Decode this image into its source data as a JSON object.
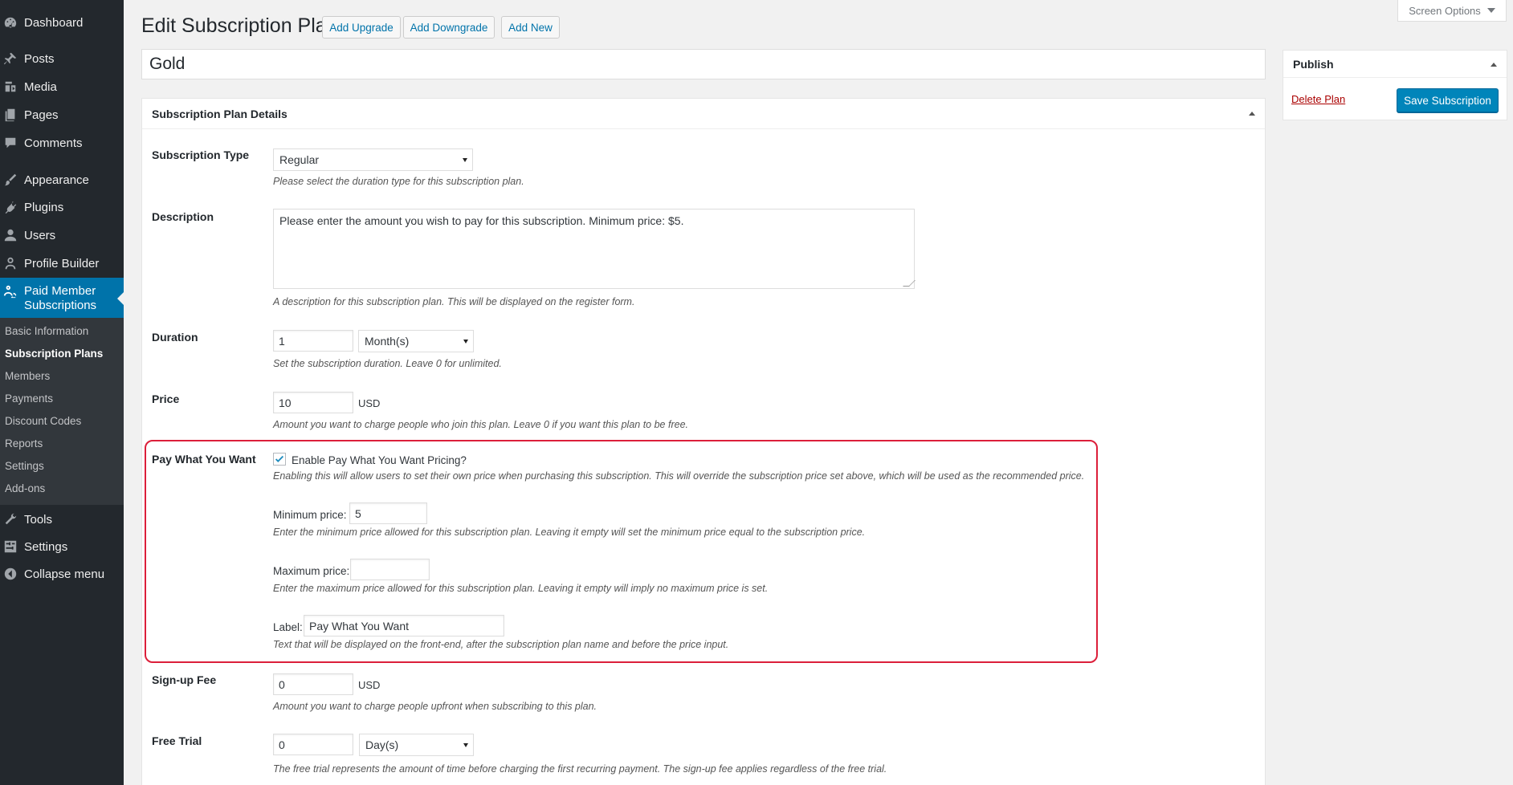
{
  "sidebar": {
    "items": [
      {
        "label": "Dashboard",
        "icon": "dashboard-icon"
      },
      {
        "label": "Posts",
        "icon": "pin-icon"
      },
      {
        "label": "Media",
        "icon": "media-icon"
      },
      {
        "label": "Pages",
        "icon": "pages-icon"
      },
      {
        "label": "Comments",
        "icon": "comment-icon"
      },
      {
        "label": "Appearance",
        "icon": "brush-icon"
      },
      {
        "label": "Plugins",
        "icon": "plug-icon"
      },
      {
        "label": "Users",
        "icon": "user-icon"
      },
      {
        "label": "Profile Builder",
        "icon": "profile-icon"
      },
      {
        "label": "Paid Member Subscriptions",
        "icon": "members-icon"
      },
      {
        "label": "Tools",
        "icon": "wrench-icon"
      },
      {
        "label": "Settings",
        "icon": "sliders-icon"
      },
      {
        "label": "Collapse menu",
        "icon": "collapse-icon"
      }
    ],
    "submenu": [
      "Basic Information",
      "Subscription Plans",
      "Members",
      "Payments",
      "Discount Codes",
      "Reports",
      "Settings",
      "Add-ons"
    ],
    "active_submenu": "Subscription Plans"
  },
  "header": {
    "title": "Edit Subscription Plan",
    "buttons": [
      "Add Upgrade",
      "Add Downgrade",
      "Add New"
    ],
    "screen_options": "Screen Options"
  },
  "plan_title": "Gold",
  "details": {
    "box_title": "Subscription Plan Details",
    "subscription_type": {
      "label": "Subscription Type",
      "value": "Regular",
      "desc": "Please select the duration type for this subscription plan."
    },
    "description": {
      "label": "Description",
      "value": "Please enter the amount you wish to pay for this subscription. Minimum price: $5.",
      "desc": "A description for this subscription plan. This will be displayed on the register form."
    },
    "duration": {
      "label": "Duration",
      "value": "1",
      "unit": "Month(s)",
      "desc": "Set the subscription duration. Leave 0 for unlimited."
    },
    "price": {
      "label": "Price",
      "value": "10",
      "currency": "USD",
      "desc": "Amount you want to charge people who join this plan. Leave 0 if you want this plan to be free."
    },
    "pwyw": {
      "label": "Pay What You Want",
      "checkbox_label": "Enable Pay What You Want Pricing?",
      "checked": true,
      "checkbox_desc": "Enabling this will allow users to set their own price when purchasing this subscription. This will override the subscription price set above, which will be used as the recommended price.",
      "min_label": "Minimum price:",
      "min_value": "5",
      "min_desc": "Enter the minimum price allowed for this subscription plan. Leaving it empty will set the minimum price equal to the subscription price.",
      "max_label": "Maximum price:",
      "max_value": "",
      "max_desc": "Enter the maximum price allowed for this subscription plan. Leaving it empty will imply no maximum price is set.",
      "text_label": "Label:",
      "text_value": "Pay What You Want",
      "text_desc": "Text that will be displayed on the front-end, after the subscription plan name and before the price input."
    },
    "signup_fee": {
      "label": "Sign-up Fee",
      "value": "0",
      "currency": "USD",
      "desc": "Amount you want to charge people upfront when subscribing to this plan."
    },
    "free_trial": {
      "label": "Free Trial",
      "value": "0",
      "unit": "Day(s)",
      "desc": "The free trial represents the amount of time before charging the first recurring payment. The sign-up fee applies regardless of the free trial."
    }
  },
  "publish": {
    "title": "Publish",
    "delete_label": "Delete Plan",
    "save_label": "Save Subscription"
  },
  "colors": {
    "sidebar_bg": "#23282d",
    "accent": "#0073aa",
    "highlight": "#dc1f3a"
  }
}
